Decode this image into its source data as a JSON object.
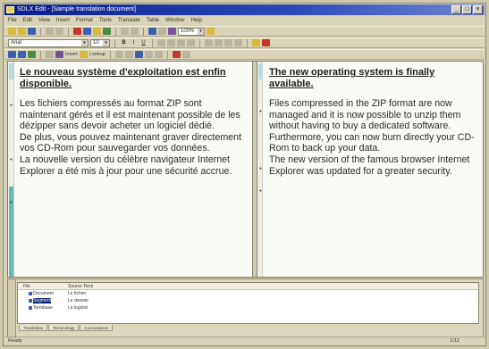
{
  "window": {
    "title": "SDLX Edit - [Sample translation document]",
    "buttons": [
      "_",
      "□",
      "×"
    ]
  },
  "menubar": [
    "File",
    "Edit",
    "View",
    "Insert",
    "Format",
    "Tools",
    "Translate",
    "Table",
    "Window",
    "Help"
  ],
  "toolbar": {
    "zoom_value": "100%",
    "font_value": "Arial",
    "size_value": "10",
    "insert_label": "Insert",
    "lookup_label": "Lookup"
  },
  "left_pane": {
    "heading": "Le nouveau système d'exploitation est enfin disponible.",
    "paragraphs": [
      "Les fichiers compressés au format ZIP sont maintenant gérés et il est maintenant possible de les dézipper sans devoir acheter un logiciel dédié.",
      "De plus, vous pouvez maintenant graver directement vos CD-Rom pour sauvegarder vos données.",
      "La nouvelle version du célèbre navigateur Internet Explorer a été mis à jour pour une sécurité accrue."
    ]
  },
  "right_pane": {
    "heading": "The new operating system is finally available.",
    "paragraphs": [
      "Files compressed in the ZIP format are now managed and it is now possible to unzip them without having to buy a dedicated software.",
      "Furthermore, you can now burn directly your CD-Rom to back up your data.",
      "The new version of the famous browser Internet Explorer was updated for a greater security."
    ]
  },
  "bottom_panel": {
    "columns": [
      "File",
      "Source Term"
    ],
    "rows": [
      {
        "name": "Document",
        "value": "Le fichier"
      },
      {
        "name": "Segment",
        "value": "Le dossier"
      },
      {
        "name": "Termbase",
        "value": "Le logiciel"
      }
    ],
    "tabs": [
      "Translation",
      "Terminology",
      "Concordance"
    ]
  },
  "statusbar": {
    "left": "Ready",
    "right": "1/12"
  }
}
